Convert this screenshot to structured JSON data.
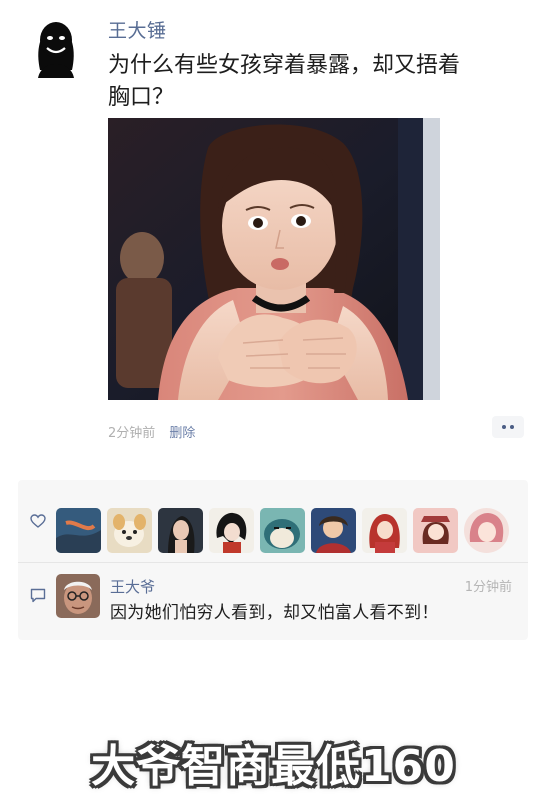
{
  "post": {
    "author": "王大锤",
    "text_line1": "为什么有些女孩穿着暴露，却又捂着",
    "text_line2": "胸口？",
    "time": "2分钟前",
    "delete_label": "删除",
    "more_icon": "ellipsis-icon"
  },
  "likes": {
    "icon": "heart-icon",
    "avatars": [
      {
        "name": "like-avatar-1",
        "color": "#3b5a78"
      },
      {
        "name": "like-avatar-2",
        "color": "#e8dcc3"
      },
      {
        "name": "like-avatar-3",
        "color": "#2d3540"
      },
      {
        "name": "like-avatar-4",
        "color": "#f2efe8"
      },
      {
        "name": "like-avatar-5",
        "color": "#7ab6b2"
      },
      {
        "name": "like-avatar-6",
        "color": "#2e4a78"
      },
      {
        "name": "like-avatar-7",
        "color": "#f2f0ea"
      },
      {
        "name": "like-avatar-8",
        "color": "#f1c8c3"
      },
      {
        "name": "like-avatar-9",
        "color": "#f4e0dc"
      }
    ]
  },
  "comment": {
    "icon": "comment-icon",
    "author": "王大爷",
    "time": "1分钟前",
    "text": "因为她们怕穷人看到，却又怕富人看不到！"
  },
  "caption": "大爷智商最低160",
  "colors": {
    "link": "#586d94",
    "meta": "#b0b0b0",
    "panel_bg": "#f7f7f7"
  }
}
